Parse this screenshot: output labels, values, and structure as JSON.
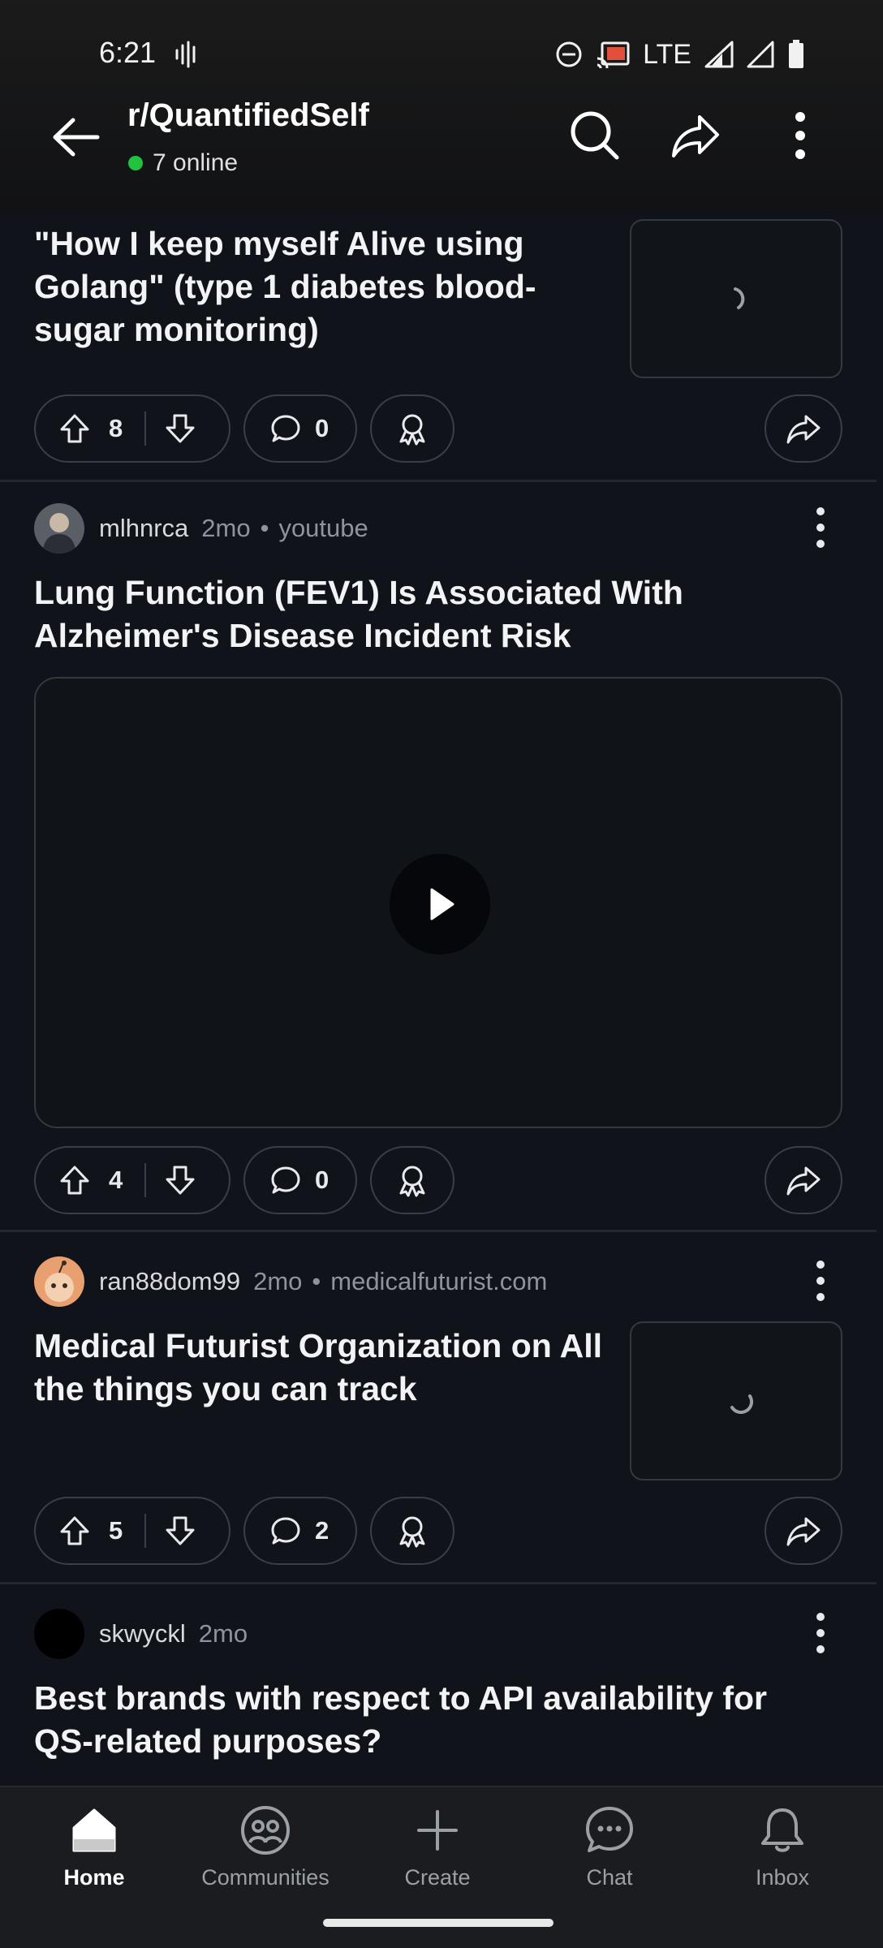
{
  "status": {
    "time": "6:21",
    "network": "LTE"
  },
  "header": {
    "subreddit": "r/QuantifiedSelf",
    "online_count": "7 online"
  },
  "posts": [
    {
      "title": "\"How I keep myself Alive using Golang\" (type 1 diabetes blood-sugar monitoring)",
      "upvotes": "8",
      "comments": "0"
    },
    {
      "author": "mlhnrca",
      "age": "2mo",
      "domain": "youtube",
      "title": "Lung Function (FEV1) Is Associated With Alzheimer's Disease Incident Risk",
      "upvotes": "4",
      "comments": "0"
    },
    {
      "author": "ran88dom99",
      "age": "2mo",
      "domain": "medicalfuturist.com",
      "title": "Medical Futurist Organization on All the things you can track",
      "upvotes": "5",
      "comments": "2"
    },
    {
      "author": "skwyckl",
      "age": "2mo",
      "title": "Best brands with respect to API availability for QS-related purposes?"
    }
  ],
  "nav": {
    "home": "Home",
    "communities": "Communities",
    "create": "Create",
    "chat": "Chat",
    "inbox": "Inbox"
  },
  "colors": {
    "online_dot": "#21c33e",
    "background": "#10131a",
    "bottom_nav": "#1a1c20"
  }
}
